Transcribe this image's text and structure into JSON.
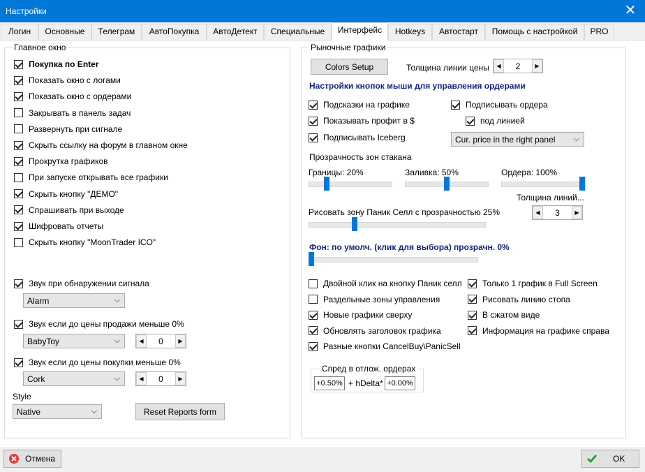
{
  "window": {
    "title": "Настройки",
    "close": "✕"
  },
  "tabs": [
    "Логин",
    "Основные",
    "Телеграм",
    "АвтоПокупка",
    "АвтоДетект",
    "Специальные",
    "Интерфейс",
    "Hotkeys",
    "Автостарт",
    "Помощь с настройкой",
    "PRO"
  ],
  "active_tab": "Интерфейс",
  "main_window": {
    "title": "Главное окно",
    "checkboxes": [
      {
        "label": "Покупка по Enter",
        "checked": true,
        "bold": true
      },
      {
        "label": "Показать окно с логами",
        "checked": true
      },
      {
        "label": "Показать окно с ордерами",
        "checked": true
      },
      {
        "label": "Закрывать в панель задач",
        "checked": false
      },
      {
        "label": "Развернуть при сигнале",
        "checked": false
      },
      {
        "label": "Скрыть ссылку на форум в главном окне",
        "checked": true
      },
      {
        "label": "Прокрутка графиков",
        "checked": true
      },
      {
        "label": "При запуске открывать все графики",
        "checked": false
      },
      {
        "label": "Скрыть кнопку \"ДЕМО\"",
        "checked": true
      },
      {
        "label": "Спрашивать при выходе",
        "checked": true
      },
      {
        "label": "Шифровать отчеты",
        "checked": true
      },
      {
        "label": "Скрыть кнопку \"MoonTrader ICO\"",
        "checked": false
      }
    ],
    "sound_signal": {
      "label": "Звук при обнаружении сигнала",
      "checked": true,
      "select": "Alarm"
    },
    "sound_sell": {
      "label": "Звук если до цены продажи меньше 0%",
      "checked": true,
      "select": "BabyToy",
      "spin": "0"
    },
    "sound_buy": {
      "label": "Звук если до цены покупки меньше 0%",
      "checked": true,
      "select": "Cork",
      "spin": "0"
    },
    "style_label": "Style",
    "style_select": "Native",
    "reset_button": "Reset Reports form"
  },
  "market_charts": {
    "title": "Рыночные графики",
    "colors_button": "Colors Setup",
    "price_line_label": "Толщина линии цены",
    "price_line_value": "2",
    "mouse_heading": "Настройки кнопок мыши для управления ордерами",
    "cb_hints": {
      "label": "Подсказки на графике",
      "checked": true
    },
    "cb_sign_orders": {
      "label": "Подписывать ордера",
      "checked": true
    },
    "cb_profit": {
      "label": "Показывать профит в $",
      "checked": true
    },
    "cb_under_line": {
      "label": "под линией",
      "checked": true
    },
    "cb_iceberg": {
      "label": "Подписывать Iceberg",
      "checked": true
    },
    "price_panel_select": "Cur. price in the right panel",
    "transparency_label": "Прозрачность зон стакана",
    "borders_label": "Границы: 20%",
    "fill_label": "Заливка: 50%",
    "orders_label": "Ордера: 100%",
    "borders_value": 0.2,
    "fill_value": 0.5,
    "orders_value": 1.0,
    "line_thickness_label": "Толщина линий...",
    "line_thickness_value": "3",
    "panic_label": "Рисовать зону Паник Селл с прозрачностью 25%",
    "panic_value": 0.25,
    "bg_label": "Фон: по умолч. (клик для выбора) прозрачн. 0%",
    "bg_value": 0,
    "left_options": [
      {
        "label": "Двойной клик на кнопку Паник селл",
        "checked": false
      },
      {
        "label": "Раздельные зоны управления",
        "checked": false
      },
      {
        "label": "Новые графики сверху",
        "checked": true
      },
      {
        "label": "Обновлять заголовок графика",
        "checked": true
      },
      {
        "label": "Разные кнопки CancelBuy\\PanicSell",
        "checked": true
      }
    ],
    "right_options": [
      {
        "label": "Только 1 график в Full Screen",
        "checked": true
      },
      {
        "label": "Рисовать линию стопа",
        "checked": true
      },
      {
        "label": "В сжатом виде",
        "checked": true
      },
      {
        "label": "Информация на графике справа",
        "checked": true
      }
    ],
    "spread": {
      "title": "Спред в отлож. ордерах",
      "v1": "+0.50%",
      "mid": "+ hDelta*",
      "v2": "+0.00%"
    }
  },
  "footer": {
    "cancel": "Отмена",
    "ok": "OK"
  },
  "colors": {
    "accent": "#0078d7",
    "heading": "#1a237e"
  }
}
